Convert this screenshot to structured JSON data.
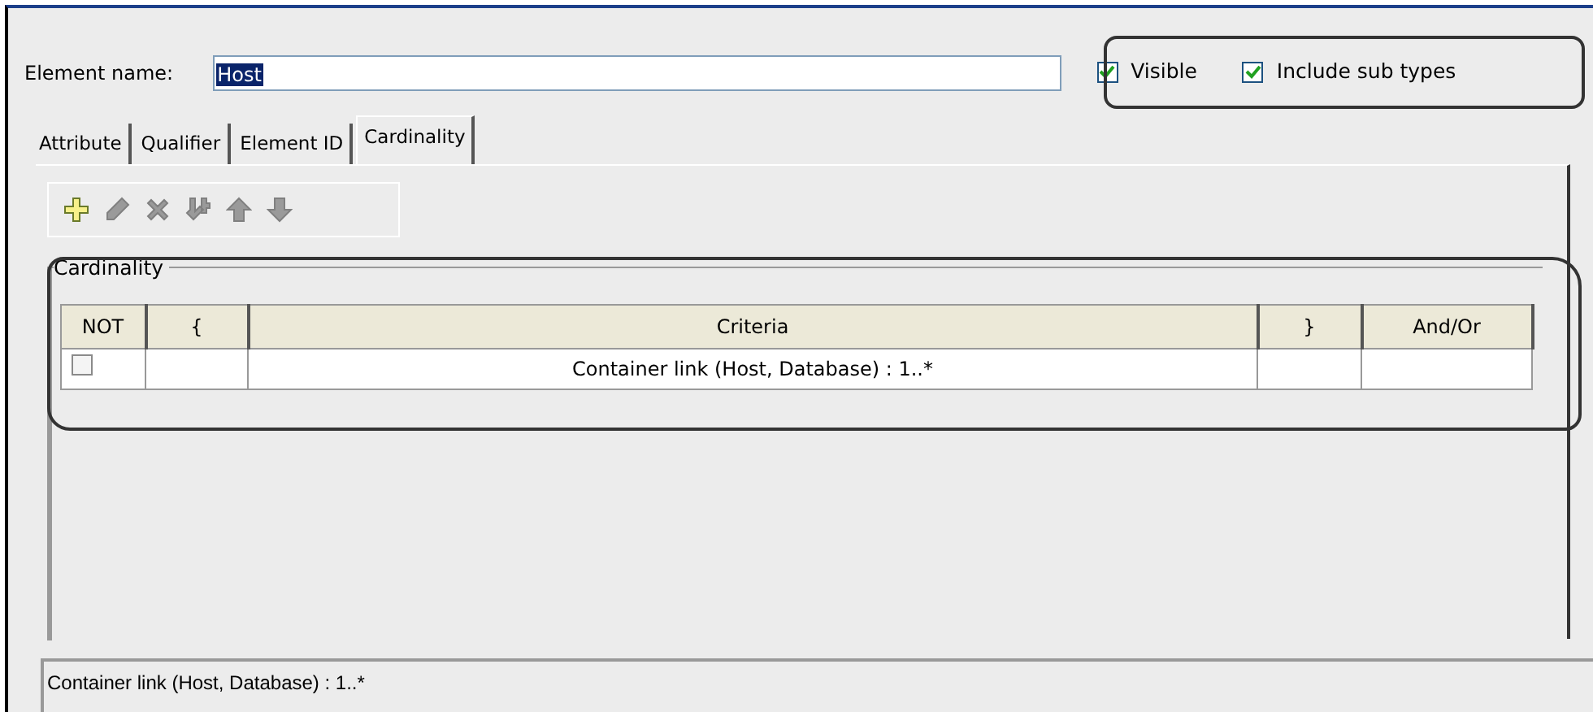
{
  "element_name": {
    "label": "Element name:",
    "value": "Host",
    "selected": true
  },
  "options": [
    {
      "label": "Visible",
      "checked": true
    },
    {
      "label": "Include sub types",
      "checked": true
    }
  ],
  "tabs": [
    {
      "label": "Attribute",
      "selected": false
    },
    {
      "label": "Qualifier",
      "selected": false
    },
    {
      "label": "Element ID",
      "selected": false
    },
    {
      "label": "Cardinality",
      "selected": true
    }
  ],
  "toolbar": [
    {
      "kind": "add",
      "disabled": false
    },
    {
      "kind": "edit",
      "disabled": true
    },
    {
      "kind": "delete",
      "disabled": true
    },
    {
      "kind": "merge",
      "disabled": true
    },
    {
      "kind": "up",
      "disabled": true
    },
    {
      "kind": "down",
      "disabled": true
    }
  ],
  "group": {
    "title": "Cardinality"
  },
  "table": {
    "columns": [
      "NOT",
      "{",
      "Criteria",
      "}",
      "And/Or"
    ],
    "rows": [
      {
        "not": false,
        "open": "",
        "criteria": "Container link (Host, Database) : 1..*",
        "close": "",
        "and_or": ""
      }
    ]
  },
  "description": "Container link (Host, Database) : 1..*"
}
